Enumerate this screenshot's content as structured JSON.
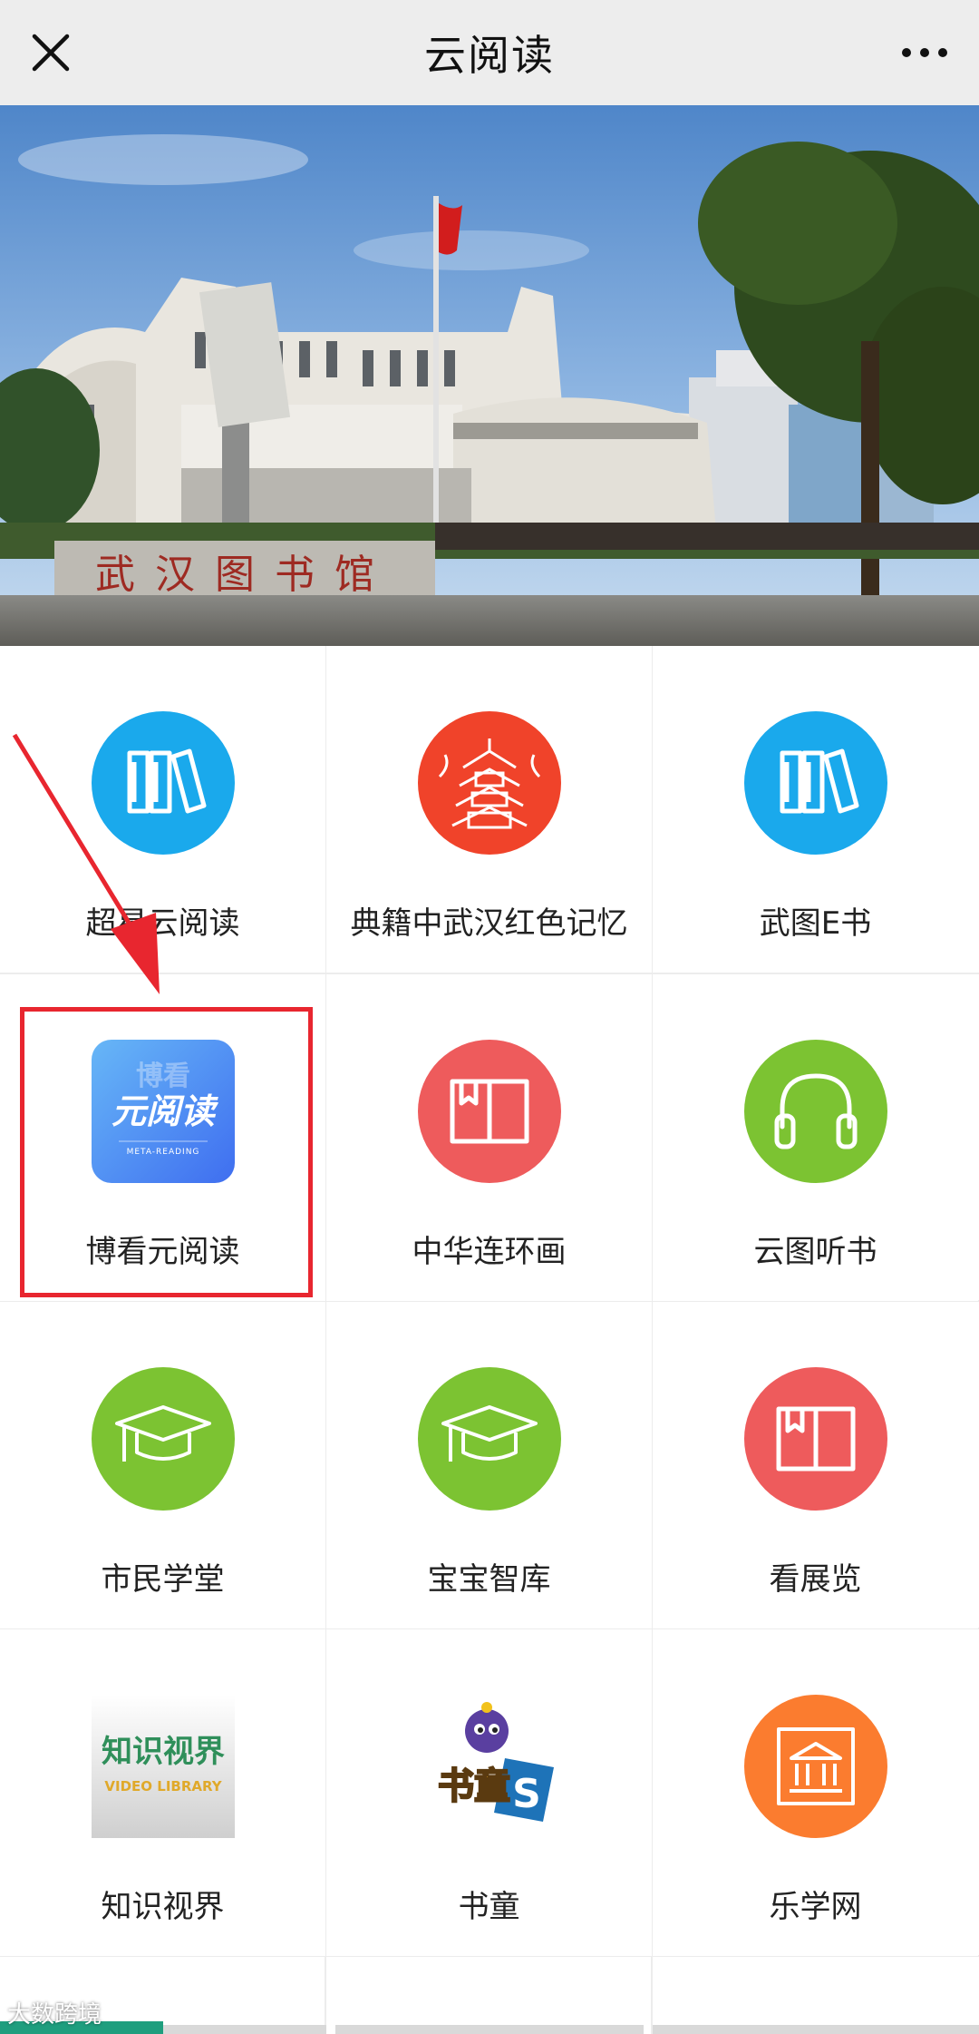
{
  "header": {
    "title": "云阅读",
    "close_icon": "close-icon",
    "more_icon": "more-horizontal-icon"
  },
  "banner": {
    "sign_text": "武汉图书馆"
  },
  "grid": {
    "items": [
      {
        "label": "超星云阅读",
        "icon": "bookshelf-icon",
        "color": "#1aa9ec"
      },
      {
        "label": "典籍中武汉红色记忆",
        "icon": "yellow-crane-tower-icon",
        "color": "#f0432a"
      },
      {
        "label": "武图E书",
        "icon": "bookshelf-icon",
        "color": "#1aa9ec"
      },
      {
        "label": "博看元阅读",
        "icon": "boku-meta-reading-logo",
        "color": "#4e86f0",
        "logo_text": "元阅读",
        "logo_subtext": "META-READING"
      },
      {
        "label": "中华连环画",
        "icon": "open-book-icon",
        "color": "#ee5b5c"
      },
      {
        "label": "云图听书",
        "icon": "headphones-icon",
        "color": "#7cc332"
      },
      {
        "label": "市民学堂",
        "icon": "graduation-cap-icon",
        "color": "#7cc332"
      },
      {
        "label": "宝宝智库",
        "icon": "graduation-cap-icon",
        "color": "#7cc332"
      },
      {
        "label": "看展览",
        "icon": "open-book-icon",
        "color": "#ee5b5c"
      },
      {
        "label": "知识视界",
        "icon": "knowledge-video-library-logo",
        "logo_text": "知识视界",
        "logo_subtext": "VIDEO LIBRARY"
      },
      {
        "label": "书童",
        "icon": "shutong-cartoon-logo",
        "logo_text": "书童"
      },
      {
        "label": "乐学网",
        "icon": "museum-icon",
        "color": "#fb7c2f"
      }
    ]
  },
  "annotation": {
    "color": "#e8262f"
  },
  "watermark": "大数跨境"
}
